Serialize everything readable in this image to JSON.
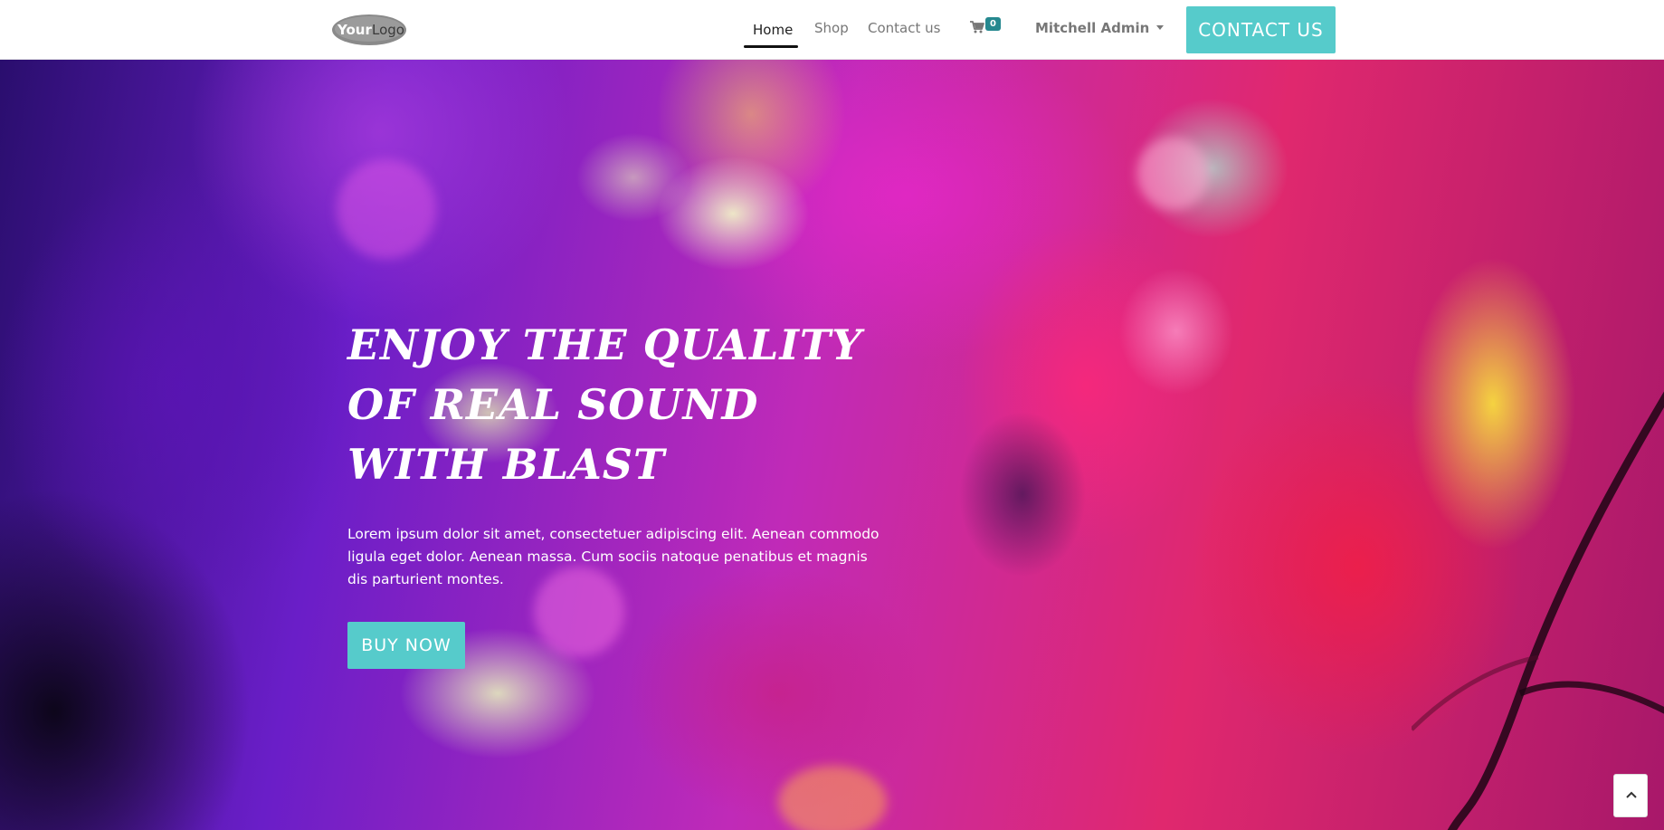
{
  "header": {
    "logo": {
      "text": "YourLogo",
      "icon": "logo-icon"
    },
    "nav": [
      {
        "label": "Home",
        "active": true
      },
      {
        "label": "Shop",
        "active": false
      },
      {
        "label": "Contact us",
        "active": false
      }
    ],
    "cart": {
      "icon": "shopping-cart-icon",
      "count": "0"
    },
    "user": {
      "name": "Mitchell Admin",
      "icon": "caret-down-icon"
    },
    "cta_label": "CONTACT US"
  },
  "hero": {
    "title": "ENJOY THE QUALITY OF REAL SOUND WITH BLAST",
    "text": "Lorem ipsum dolor sit amet, consectetuer adipiscing elit. Aenean commodo ligula eget dolor. Aenean massa. Cum sociis natoque penatibus et magnis dis parturient montes.",
    "button_label": "BUY NOW"
  },
  "scroll_top": {
    "icon": "chevron-up-icon"
  },
  "colors": {
    "accent": "#56cbcb",
    "badge": "#25888f",
    "nav_text": "#777777",
    "nav_active": "#222222"
  }
}
